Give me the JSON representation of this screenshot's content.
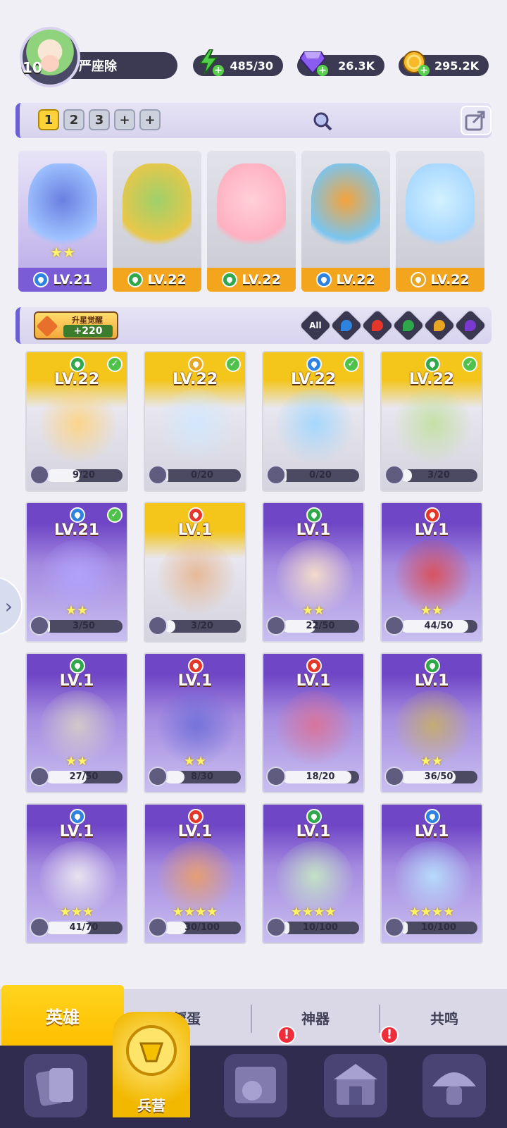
{
  "player": {
    "level": "10",
    "name": "严座除"
  },
  "resources": [
    {
      "name": "energy",
      "value": "485/30",
      "icon": "lightning-icon",
      "color": "#4ed04b"
    },
    {
      "name": "gems",
      "value": "26.3K",
      "icon": "diamond-icon",
      "color": "#8a5cf0"
    },
    {
      "name": "coins",
      "value": "295.2K",
      "icon": "coin-icon",
      "color": "#f5b92a"
    }
  ],
  "team_tabs": [
    "1",
    "2",
    "3",
    "+",
    "+"
  ],
  "lineup": [
    {
      "level": "LV.21",
      "element": "water",
      "stars": "★★"
    },
    {
      "level": "LV.22",
      "element": "wind",
      "stars": ""
    },
    {
      "level": "LV.22",
      "element": "wind",
      "stars": ""
    },
    {
      "level": "LV.22",
      "element": "water",
      "stars": ""
    },
    {
      "level": "LV.22",
      "element": "light",
      "stars": ""
    }
  ],
  "awaken": {
    "title": "升星觉醒",
    "value": "+220"
  },
  "filters": [
    "All",
    "water",
    "fire",
    "wind",
    "light",
    "dark"
  ],
  "element_colors": {
    "water": "#2f83e0",
    "fire": "#e5362a",
    "wind": "#2fa84c",
    "light": "#e8a623",
    "dark": "#7a3ad0"
  },
  "heroes": [
    {
      "level": "LV.22",
      "element": "wind",
      "progress": "9/20",
      "frac": 0.45,
      "stars": "",
      "bg": "gold",
      "check": true
    },
    {
      "level": "LV.22",
      "element": "light",
      "progress": "0/20",
      "frac": 0.0,
      "stars": "",
      "bg": "gold",
      "check": true
    },
    {
      "level": "LV.22",
      "element": "water",
      "progress": "0/20",
      "frac": 0.0,
      "stars": "",
      "bg": "gold",
      "check": true
    },
    {
      "level": "LV.22",
      "element": "wind",
      "progress": "3/20",
      "frac": 0.15,
      "stars": "",
      "bg": "gold",
      "check": true
    },
    {
      "level": "LV.21",
      "element": "water",
      "progress": "3/50",
      "frac": 0.06,
      "stars": "★★",
      "bg": "purple",
      "check": true
    },
    {
      "level": "LV.1",
      "element": "fire",
      "progress": "3/20",
      "frac": 0.15,
      "stars": "",
      "bg": "gold",
      "check": false
    },
    {
      "level": "LV.1",
      "element": "wind",
      "progress": "22/50",
      "frac": 0.44,
      "stars": "★★",
      "bg": "purple",
      "check": false
    },
    {
      "level": "LV.1",
      "element": "fire",
      "progress": "44/50",
      "frac": 0.88,
      "stars": "★★",
      "bg": "purple",
      "check": false
    },
    {
      "level": "LV.1",
      "element": "wind",
      "progress": "27/50",
      "frac": 0.54,
      "stars": "★★",
      "bg": "purple",
      "check": false
    },
    {
      "level": "LV.1",
      "element": "fire",
      "progress": "8/30",
      "frac": 0.27,
      "stars": "★★",
      "bg": "purple",
      "check": false
    },
    {
      "level": "LV.1",
      "element": "fire",
      "progress": "18/20",
      "frac": 0.9,
      "stars": "",
      "bg": "purple",
      "check": false
    },
    {
      "level": "LV.1",
      "element": "wind",
      "progress": "36/50",
      "frac": 0.72,
      "stars": "★★",
      "bg": "purple",
      "check": false
    },
    {
      "level": "LV.1",
      "element": "water",
      "progress": "41/70",
      "frac": 0.59,
      "stars": "★★★",
      "bg": "purple",
      "check": false
    },
    {
      "level": "LV.1",
      "element": "fire",
      "progress": "30/100",
      "frac": 0.3,
      "stars": "★★★★",
      "bg": "purple",
      "check": false
    },
    {
      "level": "LV.1",
      "element": "wind",
      "progress": "10/100",
      "frac": 0.1,
      "stars": "★★★★",
      "bg": "purple",
      "check": false
    },
    {
      "level": "LV.1",
      "element": "water",
      "progress": "10/100",
      "frac": 0.1,
      "stars": "★★★★",
      "bg": "purple",
      "check": false
    }
  ],
  "lower_tabs": [
    "英雄",
    "孵蛋",
    "神器",
    "共鸣"
  ],
  "bottom_nav": {
    "barracks_label": "兵营",
    "badge": "!"
  }
}
